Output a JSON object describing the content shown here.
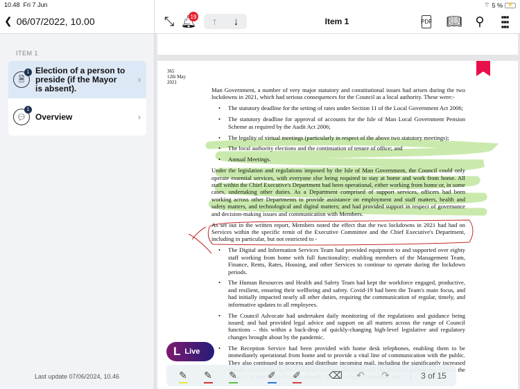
{
  "status": {
    "time": "10.48",
    "date": "Fri 7 Jun",
    "battery": "5 %"
  },
  "header": {
    "back_label": "06/07/2022, 10.00",
    "title": "Item 1",
    "notifications": "19"
  },
  "sidebar": {
    "section": "ITEM 1",
    "items": [
      {
        "label": "Election of a person to preside (if the Mayor is absent).",
        "count": "1",
        "icon": "document-icon"
      },
      {
        "label": "Overview",
        "count": "1",
        "icon": "chat-icon"
      }
    ],
    "last_update": "Last update 07/06/2024, 10.46"
  },
  "live": {
    "label": "Live",
    "logo": "L"
  },
  "doc": {
    "margin": [
      "365",
      "12th May",
      "2021"
    ],
    "p1": "Man Government, a number of very major statutory and constitutional issues had arisen during the two lockdowns in 2021, which had serious consequences for the Council as a local authority. These were:-",
    "list1": [
      "The statutory deadline for the setting of rates under Section 11 of the Local Government Act 2006;",
      "The statutory deadline for approval of accounts for the Isle of Man Local Government Pension Scheme as required by the Audit Act 2006;",
      "The legality of virtual meetings (particularly in respect of the above two statutory meetings);",
      "The local authority elections and the continuation of tenure of office; and",
      "Annual Meetings."
    ],
    "p2": "Under the legislation and regulations imposed by the Isle of Man Government, the Council could only operate essential services, with everyone else being required to stay at home and work from home. All staff within the Chief Executive's Department had been operational, either working from home or, in some cases, undertaking other duties. As a Department comprised of support services, officers had been working across other Departments to provide assistance on employment and staff matters, health and safety matters, and technological and digital matters; and had provided support in respect of governance and decision-making issues and communication with Members.",
    "p3": "As set out in the written report, Members noted the effect that the two lockdowns in 2021 had had on Services within the specific remit of the Executive Committee and the Chief Executive's Department, including in particular, but not restricted to -",
    "list2": [
      "The Digital and Information Services Team had provided equipment to and supported over eighty staff working from home with full functionality; enabling members of the Management Team, Finance, Rents, Rates, Housing, and other Services to continue to operate during the lockdown periods.",
      "The Human Resources and Health and Safety Team had kept the workforce engaged, productive, and resilient, ensuring their wellbeing and safety. Covid-19 had been the Team's main focus, and had initially impacted nearly all other duties, requiring the communication of regular, timely, and informative updates to all employees.",
      "The Council Advocate had undertaken daily monitoring of the regulations and guidance being issued; and had provided legal advice and support on all matters across the range of Council functions – this within a back-drop of quickly-changing high-level legislative and regulatory changes brought about by the pandemic.",
      "The Reception Service had been provided with home desk telephones, enabling them to be immediately operational from home and to provide a vital line of communication with the public. They also continued to process and distribute incoming mail, including the significantly increased volume of mail during the lockdown periods, and supported the decision-making function of the Council, so that it acted constitutionally, within its legal framework, and"
    ]
  },
  "toolbar": {
    "page": "3 of 15",
    "colors": {
      "yellow": "#e8e83a",
      "red": "#d63030",
      "green": "#5cc04a",
      "blue": "#2f6fd6",
      "pink": "#d63a3a"
    }
  }
}
